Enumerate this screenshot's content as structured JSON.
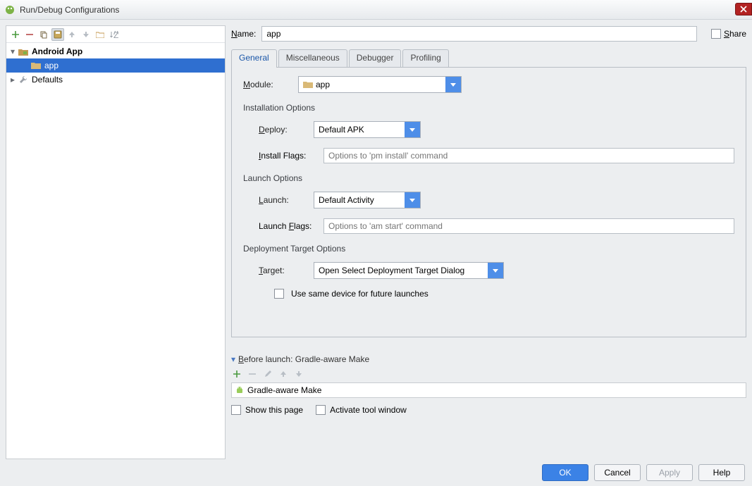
{
  "window": {
    "title": "Run/Debug Configurations"
  },
  "tree": {
    "android_app": "Android App",
    "app": "app",
    "defaults": "Defaults"
  },
  "name": {
    "label": "Name:",
    "value": "app"
  },
  "share": {
    "label": "Share"
  },
  "tabs": {
    "general": "General",
    "misc": "Miscellaneous",
    "debugger": "Debugger",
    "profiling": "Profiling"
  },
  "module": {
    "label": "Module:",
    "value": "app"
  },
  "install": {
    "section": "Installation Options",
    "deploy_label": "Deploy:",
    "deploy_value": "Default APK",
    "flags_label": "Install Flags:",
    "flags_placeholder": "Options to 'pm install' command"
  },
  "launch": {
    "section": "Launch Options",
    "launch_label": "Launch:",
    "launch_value": "Default Activity",
    "flags_label": "Launch Flags:",
    "flags_placeholder": "Options to 'am start' command"
  },
  "deploy_target": {
    "section": "Deployment Target Options",
    "target_label": "Target:",
    "target_value": "Open Select Deployment Target Dialog",
    "same_device": "Use same device for future launches"
  },
  "before": {
    "header": "Before launch: Gradle-aware Make",
    "item": "Gradle-aware Make"
  },
  "bottom_checks": {
    "show": "Show this page",
    "activate": "Activate tool window"
  },
  "buttons": {
    "ok": "OK",
    "cancel": "Cancel",
    "apply": "Apply",
    "help": "Help"
  }
}
